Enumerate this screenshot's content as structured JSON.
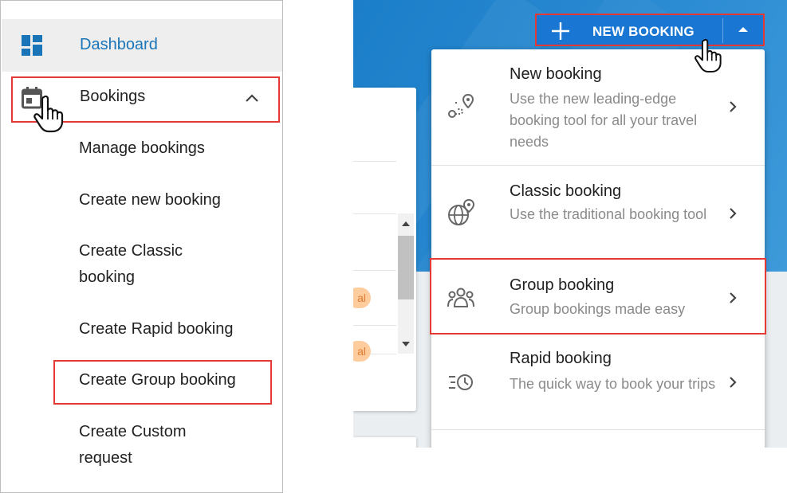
{
  "left": {
    "dashboard": {
      "label": "Dashboard",
      "icon": "dashboard-icon"
    },
    "bookings": {
      "label": "Bookings",
      "icon": "calendar-icon",
      "chevron": "chevron-up-icon"
    },
    "sub_items": [
      "Manage bookings",
      "Create new booking",
      "Create Classic booking",
      "Create Rapid booking",
      "Create Group booking",
      "Create Custom request"
    ],
    "highlighted_item": "Create Group booking"
  },
  "right": {
    "new_booking_button": {
      "label": "NEW BOOKING",
      "plus_icon": "plus-icon",
      "caret_icon": "caret-up-icon"
    },
    "background_pill_text": [
      "al",
      "al"
    ],
    "menu": [
      {
        "title": "New booking",
        "description": "Use the new leading-edge booking tool for all your travel needs",
        "icon": "route-pin-icon"
      },
      {
        "title": "Classic booking",
        "description": "Use the traditional booking tool",
        "icon": "globe-pin-icon"
      },
      {
        "title": "Group booking",
        "description": "Group bookings made easy",
        "icon": "group-people-icon"
      },
      {
        "title": "Rapid booking",
        "description": "The quick way to book your trips",
        "icon": "fast-clock-icon"
      }
    ],
    "highlighted_menu_item": "Group booking"
  },
  "colors": {
    "accent_blue": "#1a75b8",
    "button_blue": "#1976d2",
    "highlight_red": "#e53935",
    "muted_text": "#8a8a8a"
  }
}
